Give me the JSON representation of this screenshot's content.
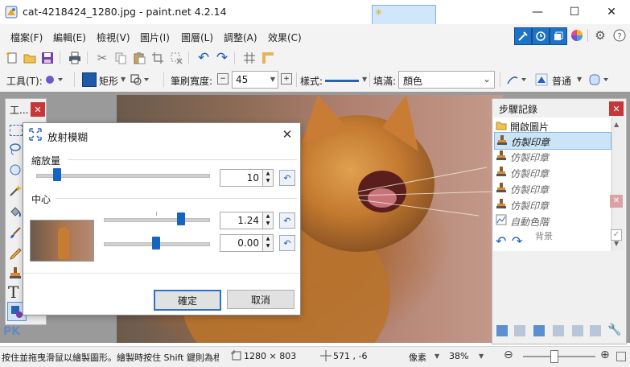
{
  "window": {
    "title": "cat-4218424_1280.jpg - paint.net 4.2.14",
    "minimize": "—",
    "maximize": "☐",
    "close": "✕"
  },
  "menu": [
    "檔案(F)",
    "編輯(E)",
    "檢視(V)",
    "圖片(I)",
    "圖層(L)",
    "調整(A)",
    "效果(C)"
  ],
  "toolbar2": {
    "tool_label": "工具(T):",
    "shape_label": "矩形",
    "brush_width_label": "筆刷寬度:",
    "brush_width_value": "45",
    "style_label": "樣式:",
    "fill_label": "填滿:",
    "fill_value": "顏色",
    "blend_label": "普通"
  },
  "tools_panel": {
    "title": "工..."
  },
  "dialog": {
    "title": "放射模糊",
    "zoom_label": "縮放量",
    "zoom_value": "10",
    "zoom_level": 0.12,
    "center_label": "中心",
    "center_x_value": "1.24",
    "center_x_level": 0.74,
    "center_y_value": "0.00",
    "center_y_level": 0.5,
    "ok_label": "確定",
    "cancel_label": "取消"
  },
  "history_panel": {
    "title": "步驟記錄",
    "items": [
      "開啟圖片",
      "仿製印章",
      "仿製印章",
      "仿製印章",
      "仿製印章",
      "仿製印章",
      "自動色階"
    ],
    "layers_overlay_label": "背景"
  },
  "status": {
    "hint": "按住並拖曳滑鼠以繪製圖形。繪製時按住 Shift 鍵則為標準形狀。",
    "image_size": "1280 × 803",
    "cursor_pos": "571 , -6",
    "unit": "像素",
    "zoom": "38%"
  },
  "watermark": "PK",
  "colors": {
    "accent": "#1565c0",
    "close_red": "#c9363a",
    "history_selected": "#cce4f7"
  }
}
